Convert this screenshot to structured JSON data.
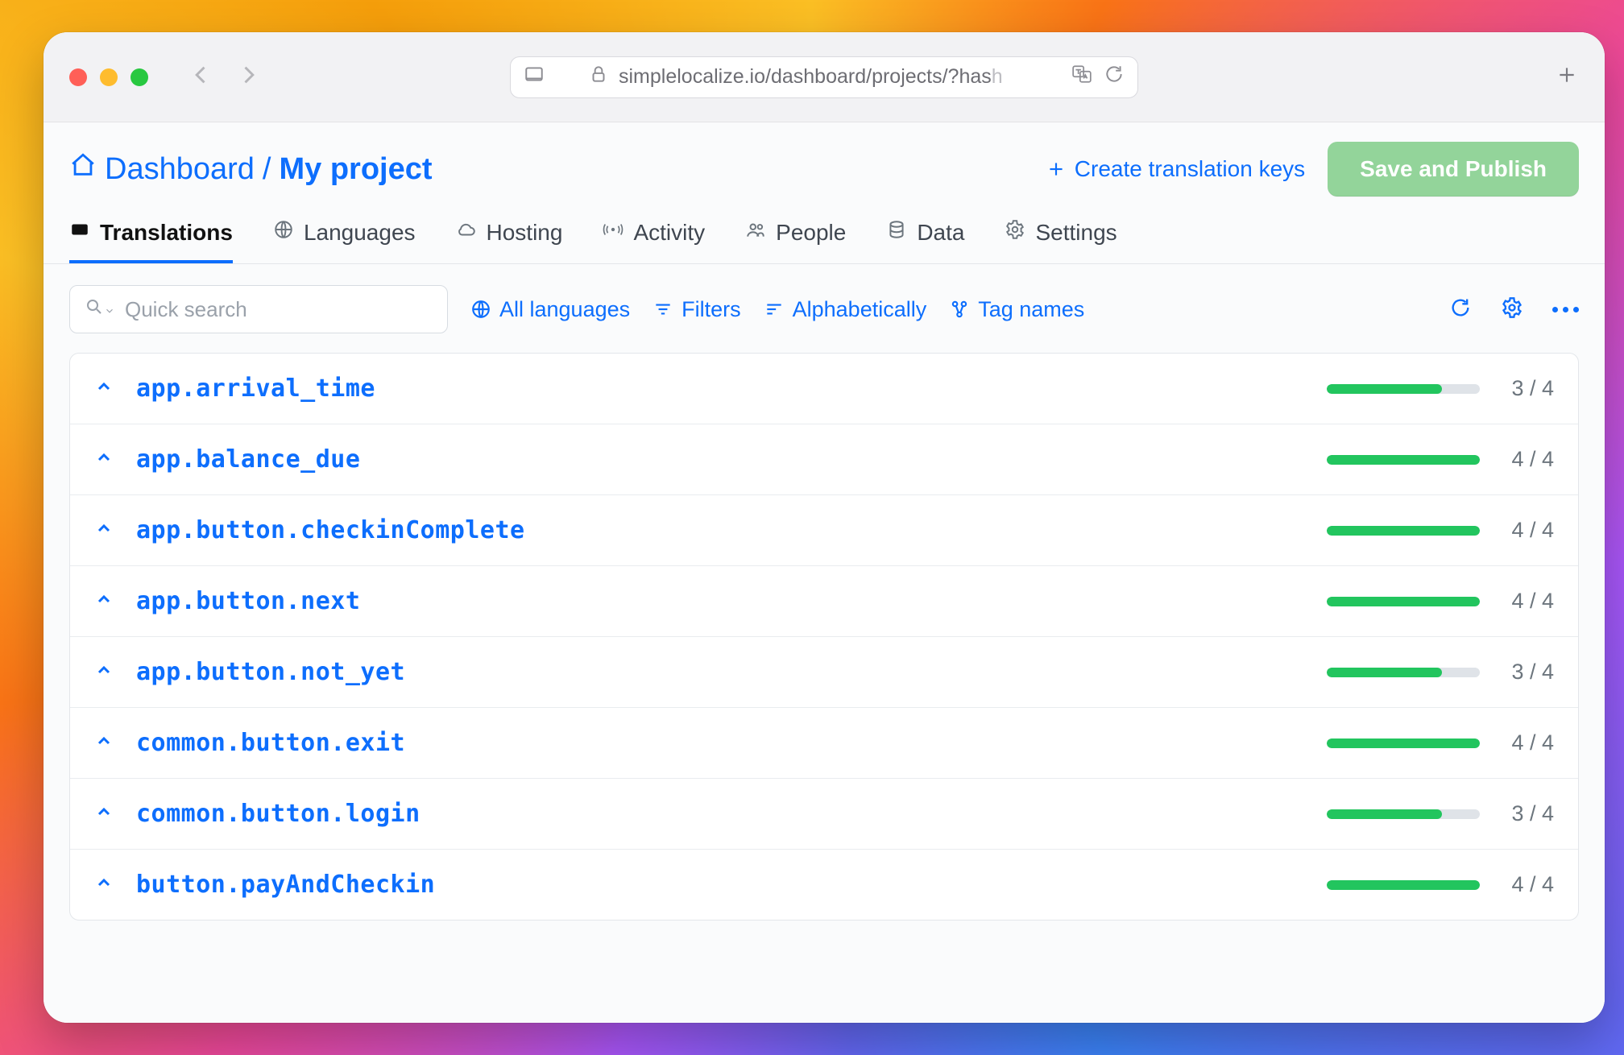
{
  "browser": {
    "url_main": "simplelocalize.io/dashboard/projects/?has",
    "url_fade": "h"
  },
  "breadcrumb": {
    "root": "Dashboard",
    "separator": "/",
    "current": "My project"
  },
  "actions": {
    "create_label": "Create translation keys",
    "publish_label": "Save and Publish"
  },
  "tabs": [
    {
      "label": "Translations",
      "icon": "translate",
      "active": true
    },
    {
      "label": "Languages",
      "icon": "globe",
      "active": false
    },
    {
      "label": "Hosting",
      "icon": "cloud",
      "active": false
    },
    {
      "label": "Activity",
      "icon": "activity",
      "active": false
    },
    {
      "label": "People",
      "icon": "people",
      "active": false
    },
    {
      "label": "Data",
      "icon": "database",
      "active": false
    },
    {
      "label": "Settings",
      "icon": "gear",
      "active": false
    }
  ],
  "toolbar": {
    "search_placeholder": "Quick search",
    "languages_label": "All languages",
    "filters_label": "Filters",
    "sort_label": "Alphabetically",
    "tags_label": "Tag names"
  },
  "keys": [
    {
      "name": "app.arrival_time",
      "done": 3,
      "total": 4
    },
    {
      "name": "app.balance_due",
      "done": 4,
      "total": 4
    },
    {
      "name": "app.button.checkinComplete",
      "done": 4,
      "total": 4
    },
    {
      "name": "app.button.next",
      "done": 4,
      "total": 4
    },
    {
      "name": "app.button.not_yet",
      "done": 3,
      "total": 4
    },
    {
      "name": "common.button.exit",
      "done": 4,
      "total": 4
    },
    {
      "name": "common.button.login",
      "done": 3,
      "total": 4
    },
    {
      "name": "button.payAndCheckin",
      "done": 4,
      "total": 4
    }
  ]
}
